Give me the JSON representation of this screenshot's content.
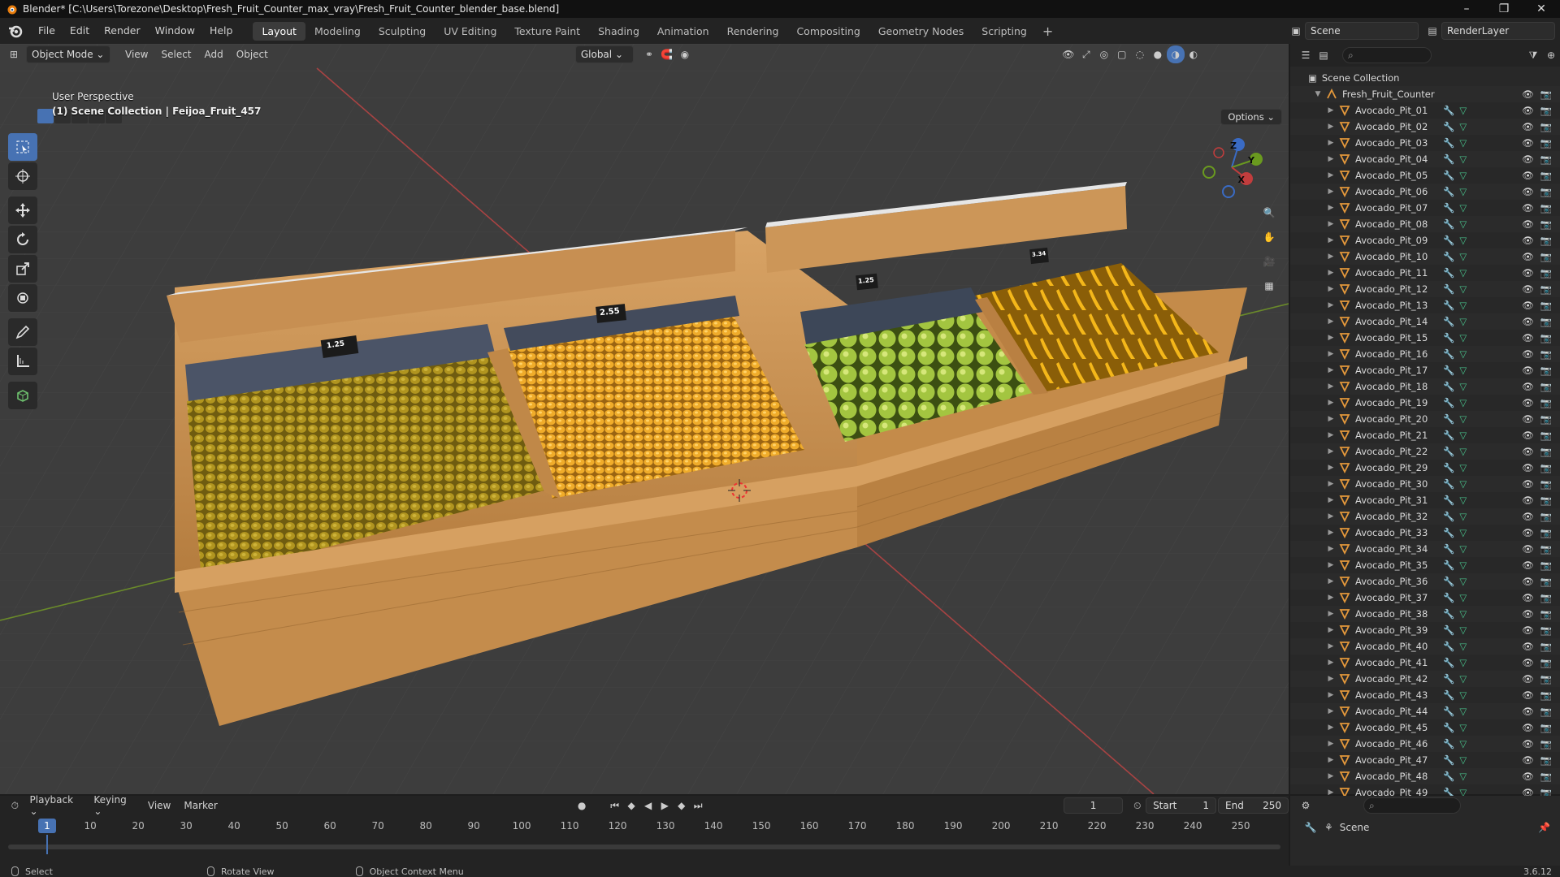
{
  "window": {
    "title": "Blender* [C:\\Users\\Torezone\\Desktop\\Fresh_Fruit_Counter_max_vray\\Fresh_Fruit_Counter_blender_base.blend]",
    "buttons": [
      "–",
      "❐",
      "✕"
    ]
  },
  "menu": [
    "File",
    "Edit",
    "Render",
    "Window",
    "Help"
  ],
  "workspaces": [
    "Layout",
    "Modeling",
    "Sculpting",
    "UV Editing",
    "Texture Paint",
    "Shading",
    "Animation",
    "Rendering",
    "Compositing",
    "Geometry Nodes",
    "Scripting"
  ],
  "active_workspace": "Layout",
  "scene_name": "Scene",
  "render_layer": "RenderLayer",
  "viewport": {
    "mode": "Object Mode",
    "menus": [
      "View",
      "Select",
      "Add",
      "Object"
    ],
    "transform_orientation": "Global",
    "options_label": "Options",
    "info_line1": "User Perspective",
    "info_line2": "(1) Scene Collection | Feijoa_Fruit_457",
    "price_tags": [
      "1.25",
      "2.55",
      "1.25",
      "3.34"
    ],
    "gizmo_axes": {
      "x": "X",
      "y": "Y",
      "z": "Z"
    },
    "colors": {
      "background": "#3d3d3d",
      "x_axis": "#c23d3d",
      "y_axis": "#6a9a1f",
      "wood": "#c8914f",
      "feijoa": "#a48a1c",
      "apricot": "#e8a52a",
      "green_apple": "#9ec43a",
      "banana": "#f3b61a"
    }
  },
  "outliner": {
    "root": "Scene Collection",
    "collection": "Fresh_Fruit_Counter",
    "items": [
      "Avocado_Pit_01",
      "Avocado_Pit_02",
      "Avocado_Pit_03",
      "Avocado_Pit_04",
      "Avocado_Pit_05",
      "Avocado_Pit_06",
      "Avocado_Pit_07",
      "Avocado_Pit_08",
      "Avocado_Pit_09",
      "Avocado_Pit_10",
      "Avocado_Pit_11",
      "Avocado_Pit_12",
      "Avocado_Pit_13",
      "Avocado_Pit_14",
      "Avocado_Pit_15",
      "Avocado_Pit_16",
      "Avocado_Pit_17",
      "Avocado_Pit_18",
      "Avocado_Pit_19",
      "Avocado_Pit_20",
      "Avocado_Pit_21",
      "Avocado_Pit_22",
      "Avocado_Pit_29",
      "Avocado_Pit_30",
      "Avocado_Pit_31",
      "Avocado_Pit_32",
      "Avocado_Pit_33",
      "Avocado_Pit_34",
      "Avocado_Pit_35",
      "Avocado_Pit_36",
      "Avocado_Pit_37",
      "Avocado_Pit_38",
      "Avocado_Pit_39",
      "Avocado_Pit_40",
      "Avocado_Pit_41",
      "Avocado_Pit_42",
      "Avocado_Pit_43",
      "Avocado_Pit_44",
      "Avocado_Pit_45",
      "Avocado_Pit_46",
      "Avocado_Pit_47",
      "Avocado_Pit_48",
      "Avocado_Pit_49"
    ]
  },
  "timeline": {
    "menus": [
      "Playback",
      "Keying",
      "View",
      "Marker"
    ],
    "current_frame": "1",
    "start_label": "Start",
    "start": "1",
    "end_label": "End",
    "end": "250",
    "ticks": [
      "1",
      "10",
      "20",
      "30",
      "40",
      "50",
      "60",
      "70",
      "80",
      "90",
      "100",
      "110",
      "120",
      "130",
      "140",
      "150",
      "160",
      "170",
      "180",
      "190",
      "200",
      "210",
      "220",
      "230",
      "240",
      "250"
    ]
  },
  "properties": {
    "scene_label": "Scene"
  },
  "status": {
    "select": "Select",
    "rotate": "Rotate View",
    "context": "Object Context Menu",
    "version": "3.6.12"
  }
}
